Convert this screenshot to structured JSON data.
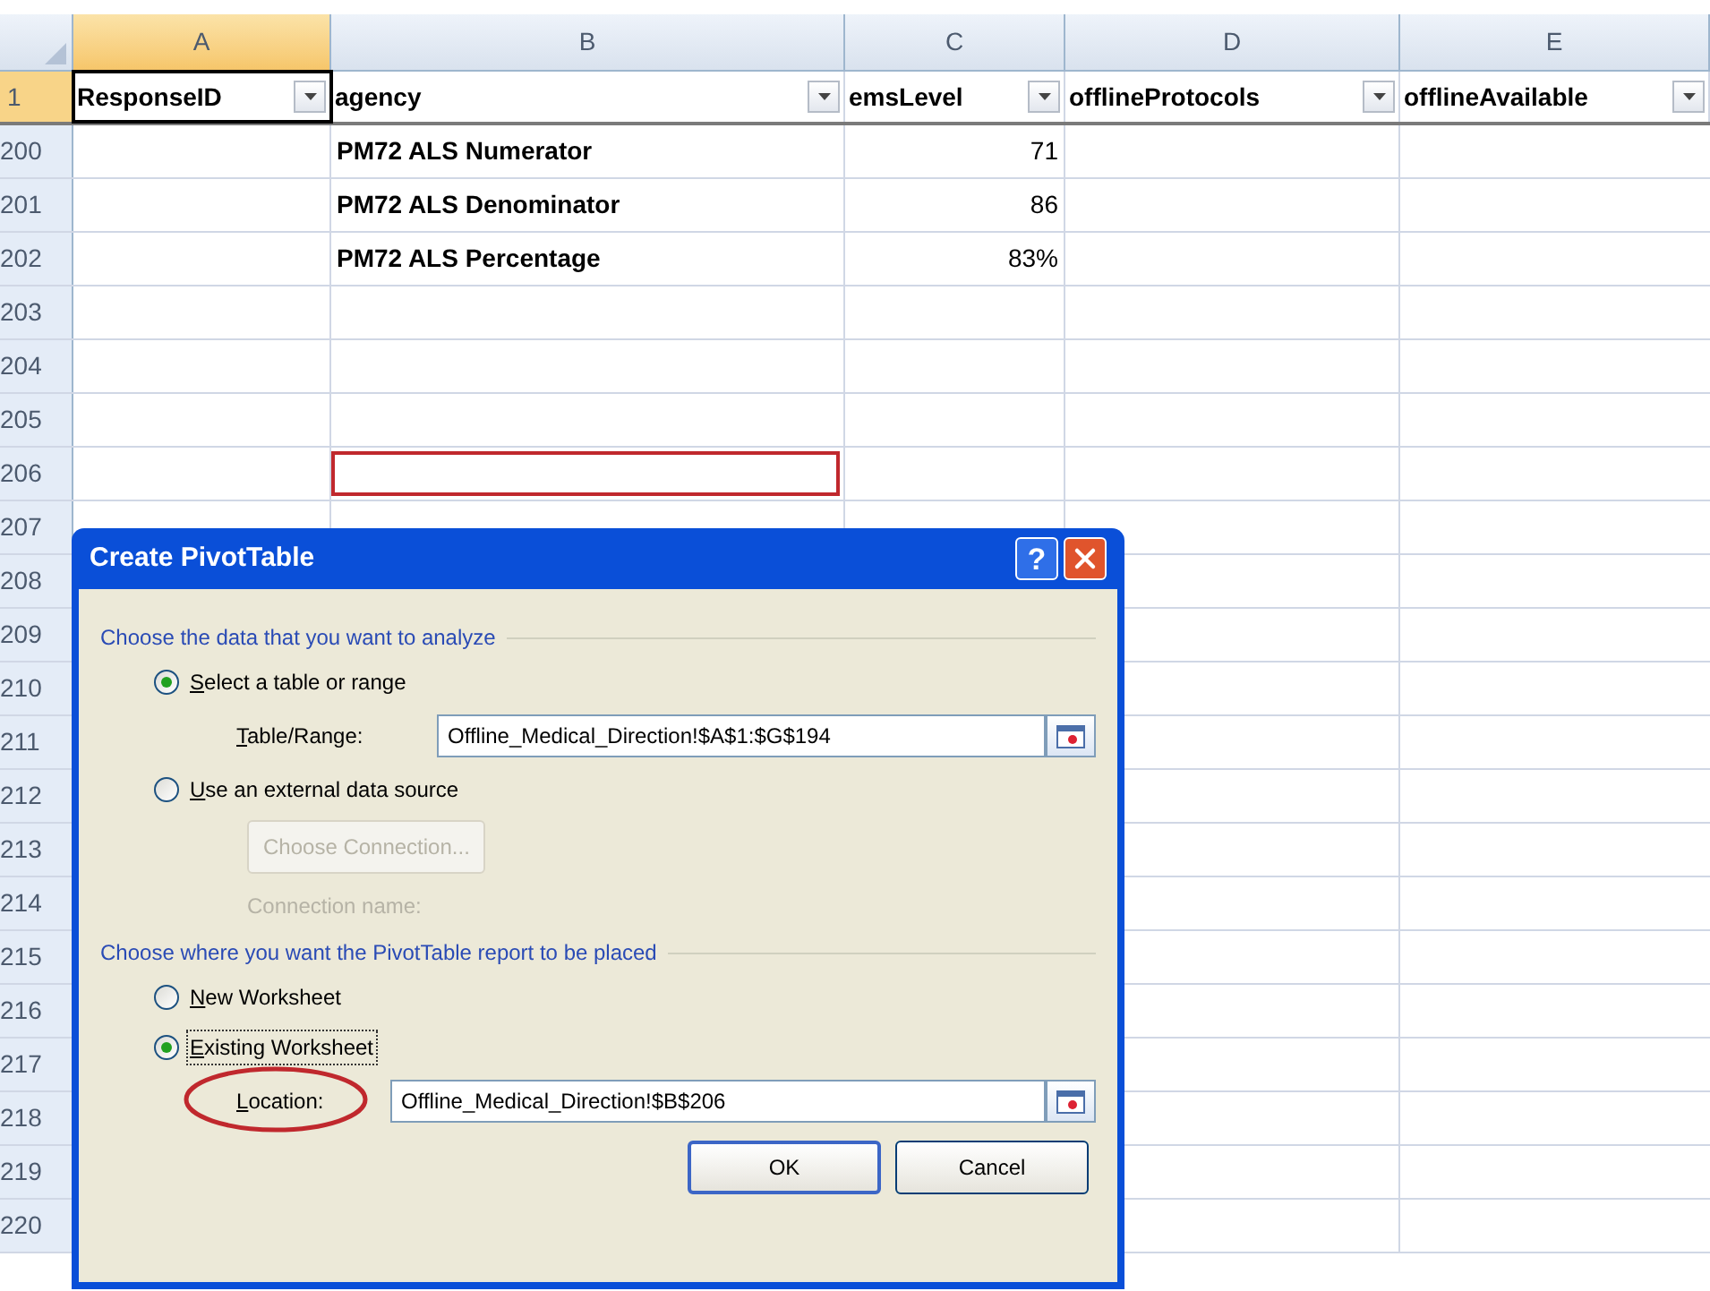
{
  "columns": [
    {
      "letter": "A",
      "selected": true
    },
    {
      "letter": "B",
      "selected": false
    },
    {
      "letter": "C",
      "selected": false
    },
    {
      "letter": "D",
      "selected": false
    },
    {
      "letter": "E",
      "selected": false
    }
  ],
  "header_row": {
    "number": "1",
    "selected": true,
    "cells": [
      "ResponseID",
      "agency",
      "emsLevel",
      "offlineProtocols",
      "offlineAvailable"
    ]
  },
  "rows": [
    {
      "number": "200",
      "agency": "PM72 ALS Numerator",
      "ems_level": "71",
      "outlined": false
    },
    {
      "number": "201",
      "agency": "PM72 ALS Denominator",
      "ems_level": "86",
      "outlined": false
    },
    {
      "number": "202",
      "agency": "PM72 ALS Percentage",
      "ems_level": "83%",
      "outlined": false
    },
    {
      "number": "203",
      "outlined": false
    },
    {
      "number": "204",
      "outlined": false
    },
    {
      "number": "205",
      "outlined": false
    },
    {
      "number": "206",
      "outlined": true
    },
    {
      "number": "207",
      "outlined": false
    },
    {
      "number": "208",
      "outlined": false
    },
    {
      "number": "209",
      "outlined": false
    },
    {
      "number": "210",
      "outlined": false
    },
    {
      "number": "211",
      "outlined": false
    },
    {
      "number": "212",
      "outlined": false
    },
    {
      "number": "213",
      "outlined": false
    },
    {
      "number": "214",
      "outlined": false
    },
    {
      "number": "215",
      "outlined": false
    },
    {
      "number": "216",
      "outlined": false
    },
    {
      "number": "217",
      "outlined": false
    },
    {
      "number": "218",
      "outlined": false
    },
    {
      "number": "219",
      "outlined": false
    },
    {
      "number": "220",
      "outlined": false
    }
  ],
  "dialog": {
    "title": "Create PivotTable",
    "help": "?",
    "sections": [
      {
        "heading": "Choose the data that you want to analyze",
        "items": [
          {
            "kind": "radio",
            "key": "S",
            "rest": "elect a table or range",
            "selected": true,
            "focused": false
          },
          {
            "kind": "field",
            "key": "T",
            "rest": "able/Range:",
            "value": "Offline_Medical_Direction!$A$1:$G$194",
            "circled": false
          },
          {
            "kind": "radio",
            "key": "U",
            "rest": "se an external data source",
            "selected": false,
            "focused": false
          },
          {
            "kind": "button",
            "label": "Choose Connection...",
            "disabled": true
          },
          {
            "kind": "caption",
            "label": "Connection name:",
            "disabled": true
          }
        ]
      },
      {
        "heading": "Choose where you want the PivotTable report to be placed",
        "items": [
          {
            "kind": "radio",
            "key": "N",
            "rest": "ew Worksheet",
            "selected": false,
            "focused": false
          },
          {
            "kind": "radio",
            "key": "E",
            "rest": "xisting Worksheet",
            "selected": true,
            "focused": true
          },
          {
            "kind": "field",
            "key": "L",
            "rest": "ocation:",
            "value": "Offline_Medical_Direction!$B$206",
            "circled": true
          }
        ]
      }
    ],
    "buttons": [
      {
        "label": "OK",
        "default": true
      },
      {
        "label": "Cancel",
        "default": false
      }
    ]
  }
}
